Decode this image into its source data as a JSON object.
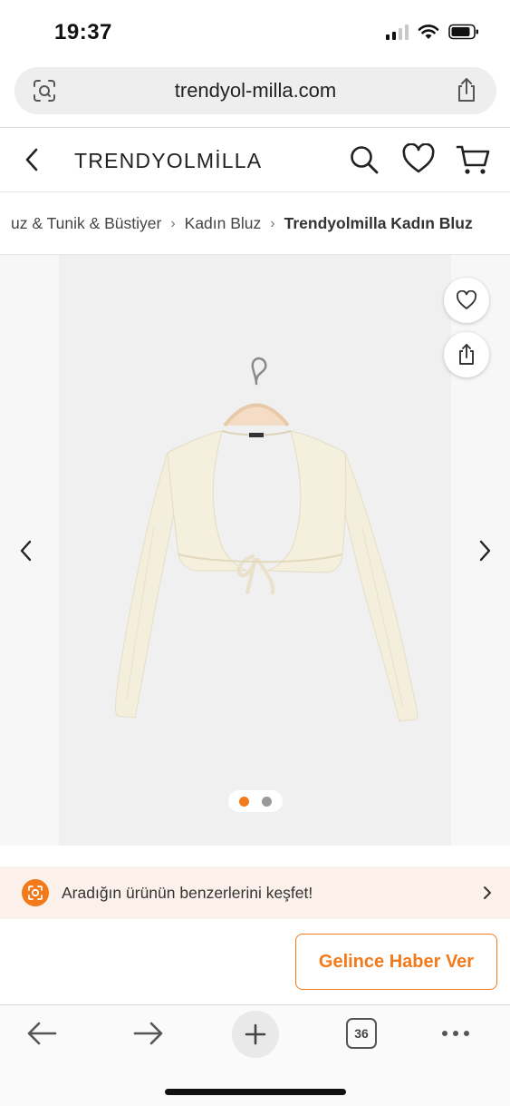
{
  "status_bar": {
    "time": "19:37"
  },
  "browser": {
    "url": "trendyol-milla.com",
    "tab_count": "36"
  },
  "header": {
    "brand": "TRENDYOLMİLLA"
  },
  "breadcrumb": {
    "items": [
      "uz & Tunik & Büstiyer",
      "Kadın Bluz",
      "Trendyolmilla Kadın Bluz"
    ]
  },
  "gallery": {
    "image_count": 2,
    "active_index": 0
  },
  "similar_banner": {
    "text": "Aradığın ürünün benzerlerini keşfet!"
  },
  "actions": {
    "notify_label": "Gelince Haber Ver"
  },
  "colors": {
    "accent": "#f27a1a",
    "banner_bg": "#fbf1ea",
    "dot_inactive": "#999999"
  },
  "icons": {
    "url_left": "screen-search-icon",
    "url_right": "share-icon",
    "header": [
      "back-chevron-icon",
      "search-icon",
      "heart-icon",
      "cart-icon"
    ],
    "gallery": [
      "heart-icon",
      "share-icon",
      "chevron-left-icon",
      "chevron-right-icon"
    ],
    "bottom": [
      "back-arrow-icon",
      "forward-arrow-icon",
      "plus-icon",
      "tabs-icon",
      "more-icon"
    ]
  }
}
